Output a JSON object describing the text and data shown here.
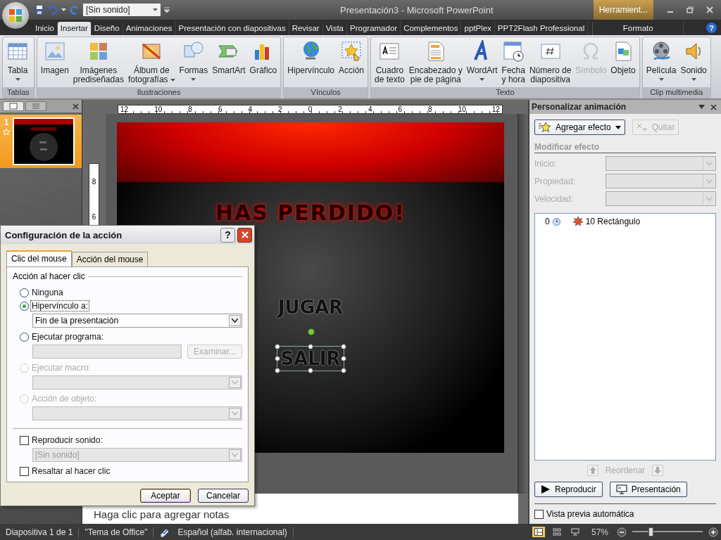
{
  "window": {
    "title": "Presentación3 - Microsoft PowerPoint",
    "context_tab": "Herramient...",
    "sound_combo": "[Sin sonido]"
  },
  "tabs": [
    {
      "label": "Inicio",
      "selected": false,
      "kind": "main"
    },
    {
      "label": "Insertar",
      "selected": true,
      "kind": "main"
    },
    {
      "label": "Diseño",
      "selected": false,
      "kind": "main"
    },
    {
      "label": "Animaciones",
      "selected": false,
      "kind": "main"
    },
    {
      "label": "Presentación con diapositivas",
      "selected": false,
      "kind": "main"
    },
    {
      "label": "Revisar",
      "selected": false,
      "kind": "main"
    },
    {
      "label": "Vista",
      "selected": false,
      "kind": "main"
    },
    {
      "label": "Programador",
      "selected": false,
      "kind": "main"
    },
    {
      "label": "Complementos",
      "selected": false,
      "kind": "main"
    },
    {
      "label": "pptPlex",
      "selected": false,
      "kind": "main"
    },
    {
      "label": "PPT2Flash Professional",
      "selected": false,
      "kind": "main"
    },
    {
      "label": "Formato",
      "selected": false,
      "kind": "context"
    }
  ],
  "help": "?",
  "ribbon": {
    "groups": [
      {
        "label": "Tablas",
        "commands": [
          {
            "lines": [
              "Tabla"
            ],
            "kind": "table",
            "dropdown": true,
            "disabled": false
          }
        ]
      },
      {
        "label": "Ilustraciones",
        "commands": [
          {
            "lines": [
              "Imagen"
            ],
            "kind": "picture",
            "dropdown": false,
            "disabled": false
          },
          {
            "lines": [
              "Imágenes",
              "prediseñadas"
            ],
            "kind": "clipart",
            "dropdown": false,
            "disabled": false
          },
          {
            "lines": [
              "Álbum de",
              "fotografías"
            ],
            "kind": "album",
            "dropdown": true,
            "disabled": false
          },
          {
            "lines": [
              "Formas"
            ],
            "kind": "shapes",
            "dropdown": true,
            "disabled": false
          },
          {
            "lines": [
              "SmartArt"
            ],
            "kind": "smartart",
            "dropdown": false,
            "disabled": false
          },
          {
            "lines": [
              "Gráfico"
            ],
            "kind": "chart",
            "dropdown": false,
            "disabled": false
          }
        ]
      },
      {
        "label": "Vínculos",
        "commands": [
          {
            "lines": [
              "Hipervínculo"
            ],
            "kind": "globe",
            "dropdown": false,
            "disabled": false
          },
          {
            "lines": [
              "Acción"
            ],
            "kind": "action",
            "dropdown": false,
            "disabled": false
          }
        ]
      },
      {
        "label": "Texto",
        "commands": [
          {
            "lines": [
              "Cuadro",
              "de texto"
            ],
            "kind": "textbox",
            "dropdown": false,
            "disabled": false
          },
          {
            "lines": [
              "Encabezado y",
              "pie de página"
            ],
            "kind": "header",
            "dropdown": false,
            "disabled": false
          },
          {
            "lines": [
              "WordArt"
            ],
            "kind": "wordart",
            "dropdown": true,
            "disabled": false
          },
          {
            "lines": [
              "Fecha",
              "y hora"
            ],
            "kind": "date",
            "dropdown": false,
            "disabled": false
          },
          {
            "lines": [
              "Número de",
              "diapositiva"
            ],
            "kind": "slidenum",
            "dropdown": false,
            "disabled": false
          },
          {
            "lines": [
              "Símbolo"
            ],
            "kind": "symbol",
            "dropdown": false,
            "disabled": true
          },
          {
            "lines": [
              "Objeto"
            ],
            "kind": "object",
            "dropdown": false,
            "disabled": false
          }
        ]
      },
      {
        "label": "Clip multimedia",
        "commands": [
          {
            "lines": [
              "Película"
            ],
            "kind": "movie",
            "dropdown": true,
            "disabled": false
          },
          {
            "lines": [
              "Sonido"
            ],
            "kind": "sound",
            "dropdown": true,
            "disabled": false
          }
        ]
      }
    ]
  },
  "slides_pane": {
    "tabs": [
      {
        "kind": "slides",
        "selected": true
      },
      {
        "kind": "outline",
        "selected": false
      }
    ],
    "slides": [
      {
        "number": "1",
        "selected": true,
        "animated": true
      }
    ]
  },
  "ruler": {
    "horizontal": [
      "12",
      "10",
      "8",
      "6",
      "4",
      "2",
      "0",
      "2",
      "4",
      "6",
      "8",
      "10",
      "12"
    ],
    "vertical": [
      "8",
      "6"
    ]
  },
  "slide": {
    "title": "HAS PERDIDO!",
    "items": [
      {
        "label": "JUGAR",
        "selected": false
      },
      {
        "label": "SALIR",
        "selected": true
      }
    ]
  },
  "notes": {
    "placeholder": "Haga clic para agregar notas"
  },
  "dialog": {
    "title": "Configuración de la acción",
    "help": "?",
    "tabs": [
      {
        "label": "Clic del mouse",
        "selected": true
      },
      {
        "label": "Acción del mouse",
        "selected": false
      }
    ],
    "group_label": "Acción al hacer clic",
    "options": [
      {
        "kind": "radio",
        "label": "Ninguna",
        "selected": false,
        "disabled": false
      },
      {
        "kind": "radio",
        "label": "Hipervínculo a:",
        "selected": true,
        "disabled": false,
        "dropdown": {
          "value": "Fin de la presentación",
          "disabled": false
        }
      },
      {
        "kind": "radio",
        "label": "Ejecutar programa:",
        "selected": false,
        "disabled": false,
        "field": {
          "disabled": true
        },
        "button": {
          "label": "Examinar...",
          "disabled": true
        }
      },
      {
        "kind": "radio",
        "label": "Ejecutar macro:",
        "selected": false,
        "disabled": true,
        "dropdown": {
          "disabled": true
        }
      },
      {
        "kind": "radio",
        "label": "Acción de objeto:",
        "selected": false,
        "disabled": true,
        "dropdown": {
          "disabled": true
        }
      },
      {
        "kind": "checkbox",
        "label": "Reproducir sonido:",
        "checked": false,
        "disabled": false,
        "dropdown": {
          "value": "[Sin sonido]",
          "disabled": true
        }
      },
      {
        "kind": "checkbox",
        "label": "Resaltar al hacer clic",
        "checked": false,
        "disabled": false
      }
    ],
    "buttons": [
      {
        "label": "Aceptar",
        "default": true
      },
      {
        "label": "Cancelar",
        "default": false
      }
    ]
  },
  "task_pane": {
    "title": "Personalizar animación",
    "add_button": "Agregar efecto",
    "remove_button": {
      "label": "Quitar",
      "disabled": true
    },
    "section": "Modificar efecto",
    "fields": [
      {
        "label": "Inicio:",
        "disabled": true
      },
      {
        "label": "Propiedad:",
        "disabled": true
      },
      {
        "label": "Velocidad:",
        "disabled": true
      }
    ],
    "effects": [
      {
        "order": "0",
        "name": "10 Rectángulo"
      }
    ],
    "reorder": "Reordenar",
    "play_button": "Reproducir",
    "show_button": "Presentación",
    "autopreview": {
      "label": "Vista previa automática",
      "checked": false
    }
  },
  "status_bar": {
    "items": [
      "Diapositiva 1 de 1",
      "\"Tema de Office\"",
      "Español (alfab. internacional)"
    ],
    "views": [
      {
        "kind": "normal",
        "selected": true
      },
      {
        "kind": "sorter",
        "selected": false
      },
      {
        "kind": "show",
        "selected": false
      }
    ],
    "zoom": "57%",
    "zoom_slider": {
      "level": 0.27
    }
  }
}
